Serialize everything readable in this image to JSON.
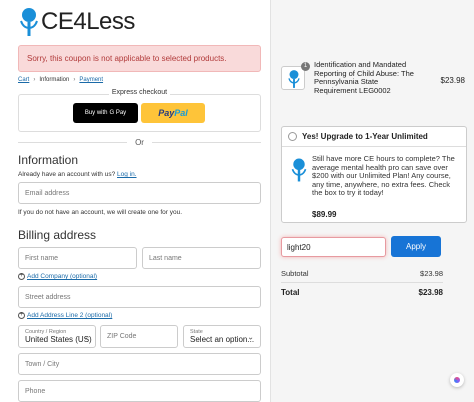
{
  "logo": {
    "text": "CE4Less"
  },
  "error": {
    "message": "Sorry, this coupon is not applicable to selected products."
  },
  "breadcrumb": {
    "items": [
      "Cart",
      "Information",
      "Payment"
    ],
    "sep": "›"
  },
  "express": {
    "label": "Express checkout",
    "gpay_label": "Buy with",
    "gpay_brand": "G Pay",
    "paypal_part1": "Pay",
    "paypal_part2": "Pal"
  },
  "or_label": "Or",
  "information": {
    "heading": "Information",
    "account_prompt": "Already have an account with us?",
    "login_link": "Log in.",
    "email_placeholder": "Email address",
    "no_account_note": "If you do not have an account, we will create one for you."
  },
  "billing": {
    "heading": "Billing address",
    "first_name": "First name",
    "last_name": "Last name",
    "add_company": "Add Company (optional)",
    "street": "Street address",
    "add_line2": "Add Address Line 2 (optional)",
    "country_label": "Country / Region",
    "country_value": "United States (US)",
    "zip": "ZIP Code",
    "state_label": "State",
    "state_value": "Select an option...",
    "city": "Town / City",
    "phone": "Phone"
  },
  "order": {
    "item": {
      "quantity": "1",
      "title": "Identification and Mandated Reporting of Child Abuse: The Pennsylvania State Requirement LEG0002",
      "price": "$23.98"
    },
    "upsell": {
      "heading": "Yes! Upgrade to 1-Year Unlimited",
      "text": "Still have more CE hours to complete? The average mental health pro can save over $200 with our Unlimited Plan! Any course, any time, anywhere, no extra fees. Check the box to try it today!",
      "price": "$89.99"
    },
    "coupon_value": "light20",
    "apply_label": "Apply",
    "subtotal_label": "Subtotal",
    "subtotal_value": "$23.98",
    "total_label": "Total",
    "total_value": "$23.98"
  },
  "colors": {
    "accent": "#1774d6",
    "error_bg": "#f9dada",
    "error_text": "#b13a3a",
    "brand_blue": "#1a8fd8"
  }
}
